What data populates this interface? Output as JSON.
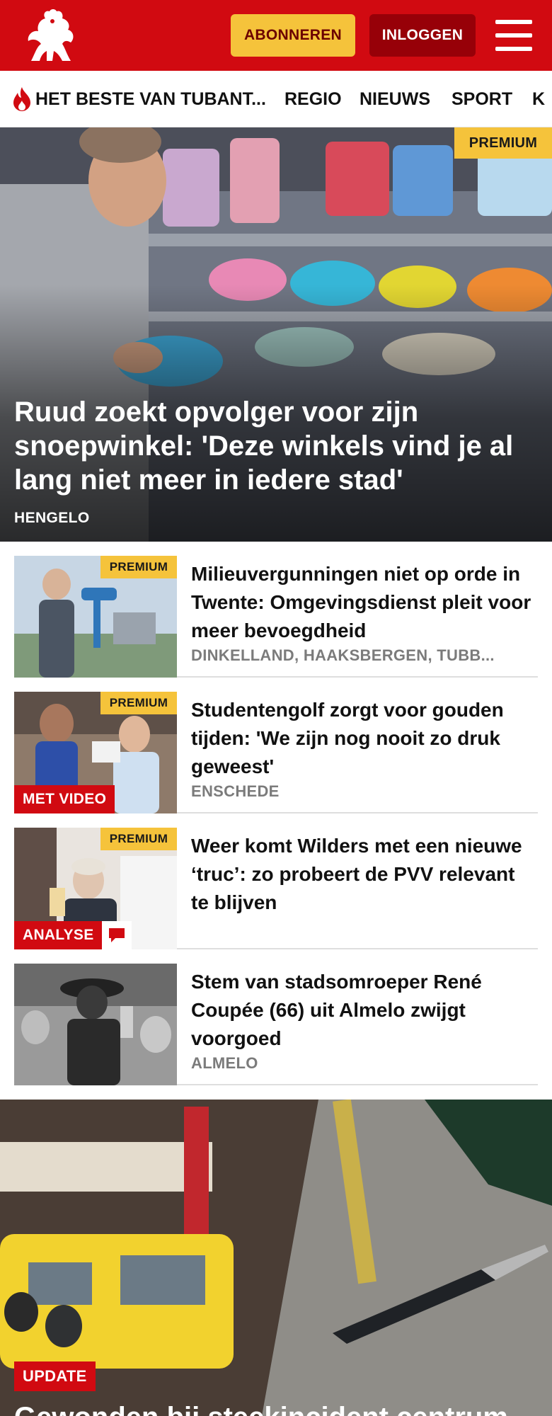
{
  "header": {
    "subscribe_label": "ABONNEREN",
    "login_label": "INLOGGEN",
    "brand_color": "#d10a11",
    "icons": [
      "twente-horse-logo",
      "menu-icon"
    ]
  },
  "nav": {
    "items": [
      "HET BESTE VAN TUBANT...",
      "REGIO",
      "NIEUWS",
      "SPORT",
      "K"
    ]
  },
  "hero": {
    "badge": "PREMIUM",
    "title": "Ruud zoekt opvolger voor zijn snoepwinkel: 'Deze winkels vind je al lang niet meer in iedere stad'",
    "place": "HENGELO"
  },
  "articles": [
    {
      "badge": "PREMIUM",
      "tag": "",
      "title": "Milieuvergunningen niet op orde in Twente: Omgevingsdienst pleit voor meer bevoegdheid",
      "place": "DINKELLAND, HAAKSBERGEN, TUBB..."
    },
    {
      "badge": "PREMIUM",
      "tag": "MET VIDEO",
      "title": "Studentengolf zorgt voor gouden tijden: 'We zijn nog nooit zo druk geweest'",
      "place": "ENSCHEDE"
    },
    {
      "badge": "PREMIUM",
      "tag": "ANALYSE",
      "title": "Weer komt Wilders met een nieuwe ‘truc’: zo probeert de PVV relevant te blijven",
      "place": ""
    },
    {
      "badge": "",
      "tag": "",
      "title": "Stem van stadsomroeper René Coupée (66) uit Almelo zwijgt voorgoed",
      "place": "ALMELO"
    }
  ],
  "hero2": {
    "tag": "UPDATE",
    "title": "Gewonden bij steekincident centrum"
  }
}
